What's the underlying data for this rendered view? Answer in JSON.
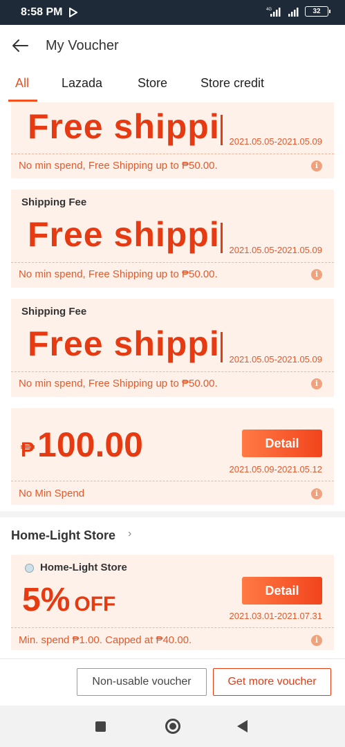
{
  "status_bar": {
    "time": "8:58 PM",
    "network": "4G",
    "battery": "32"
  },
  "header": {
    "title": "My Voucher",
    "back_icon": "arrow-left-icon"
  },
  "tabs": [
    {
      "label": "All",
      "active": true
    },
    {
      "label": "Lazada",
      "active": false
    },
    {
      "label": "Store",
      "active": false
    },
    {
      "label": "Store credit",
      "active": false
    }
  ],
  "vouchers": [
    {
      "category": "",
      "title": "Free shippi",
      "date_range": "2021.05.05-2021.05.09",
      "description": "No min spend, Free Shipping up to ₱50.00."
    },
    {
      "category": "Shipping Fee",
      "title": "Free shippi",
      "date_range": "2021.05.05-2021.05.09",
      "description": "No min spend, Free Shipping up to ₱50.00."
    },
    {
      "category": "Shipping Fee",
      "title": "Free shippi",
      "date_range": "2021.05.05-2021.05.09",
      "description": "No min spend, Free Shipping up to ₱50.00."
    },
    {
      "currency_symbol": "₱",
      "amount": "100.00",
      "button_label": "Detail",
      "date_range": "2021.05.09-2021.05.12",
      "description": "No Min Spend"
    }
  ],
  "store_section": {
    "heading": "Home-Light Store",
    "chevron": "›",
    "voucher": {
      "store_name": "Home-Light Store",
      "percent": "5%",
      "off_label": "OFF",
      "button_label": "Detail",
      "date_range": "2021.03.01-2021.07.31",
      "description": "Min. spend ₱1.00. Capped at ₱40.00."
    }
  },
  "bottom_actions": {
    "non_usable_label": "Non-usable voucher",
    "get_more_label": "Get more voucher"
  },
  "info_glyph": "i",
  "colors": {
    "accent": "#e63b12",
    "voucher_bg": "#fdf1ea",
    "status_bar_bg": "#1e2a38"
  }
}
